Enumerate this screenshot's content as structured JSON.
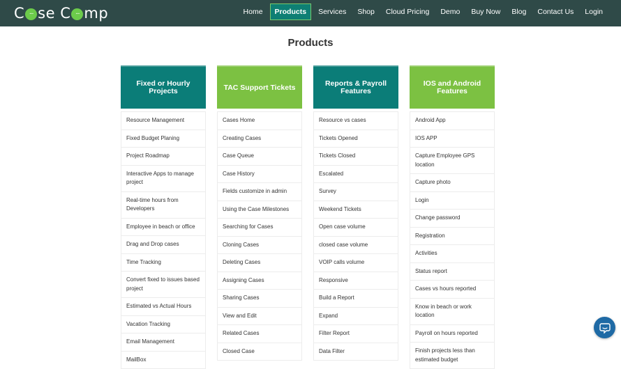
{
  "logo": {
    "part1": "C",
    "part2": "se C",
    "part3": "mp",
    "bubble_dots": "..."
  },
  "nav": {
    "items": [
      {
        "label": "Home",
        "active": false
      },
      {
        "label": "Products",
        "active": true
      },
      {
        "label": "Services",
        "active": false
      },
      {
        "label": "Shop",
        "active": false
      },
      {
        "label": "Cloud Pricing",
        "active": false
      },
      {
        "label": "Demo",
        "active": false
      },
      {
        "label": "Buy Now",
        "active": false
      },
      {
        "label": "Blog",
        "active": false
      },
      {
        "label": "Contact Us",
        "active": false
      },
      {
        "label": "Login",
        "active": false
      }
    ]
  },
  "page": {
    "title": "Products"
  },
  "columns": [
    {
      "title": "Fixed or Hourly Projects",
      "color": "#0b7d78",
      "items": [
        "Resource Management",
        "Fixed Budget Planing",
        "Project Roadmap",
        "Interactive Apps to manage project",
        "Real-time hours from Developers",
        "Employee in beach or office",
        "Drag and Drop cases",
        "Time Tracking",
        "Convert fixed to issues based project",
        "Estimated vs Actual Hours",
        "Vacation Tracking",
        "Email Management",
        "MailBox"
      ]
    },
    {
      "title": "TAC Support Tickets",
      "color": "#7cc142",
      "items": [
        "Cases Home",
        "Creating Cases",
        "Case Queue",
        "Case History",
        "Fields customize in admin",
        "Using the Case Milestones",
        "Searching for Cases",
        "Cloning Cases",
        "Deleting Cases",
        "Assigning Cases",
        "Sharing Cases",
        "View and Edit",
        "Related Cases",
        "Closed Case"
      ]
    },
    {
      "title": "Reports & Payroll Features",
      "color": "#0b7d78",
      "items": [
        "Resource vs cases",
        "Tickets Opened",
        "Tickets Closed",
        "Escalated",
        "Survey",
        "Weekend Tickets",
        "Open case volume",
        "closed case volume",
        "VOIP calls volume",
        "Responsive",
        "Build a Report",
        "Expand",
        "Filter Report",
        "Data Filter"
      ]
    },
    {
      "title": "IOS and Android Features",
      "color": "#7cc142",
      "items": [
        "Android App",
        "IOS APP",
        "Capture Employee GPS location",
        "Capture photo",
        "Login",
        "Change password",
        "Registration",
        "Activities",
        "Status report",
        "Cases vs hours reported",
        "Know in beach or work location",
        "Payroll on hours reported",
        "Finish projects less than estimated budget"
      ]
    }
  ],
  "chat": {
    "icon": "chat-icon",
    "color": "#1f6aa5"
  }
}
